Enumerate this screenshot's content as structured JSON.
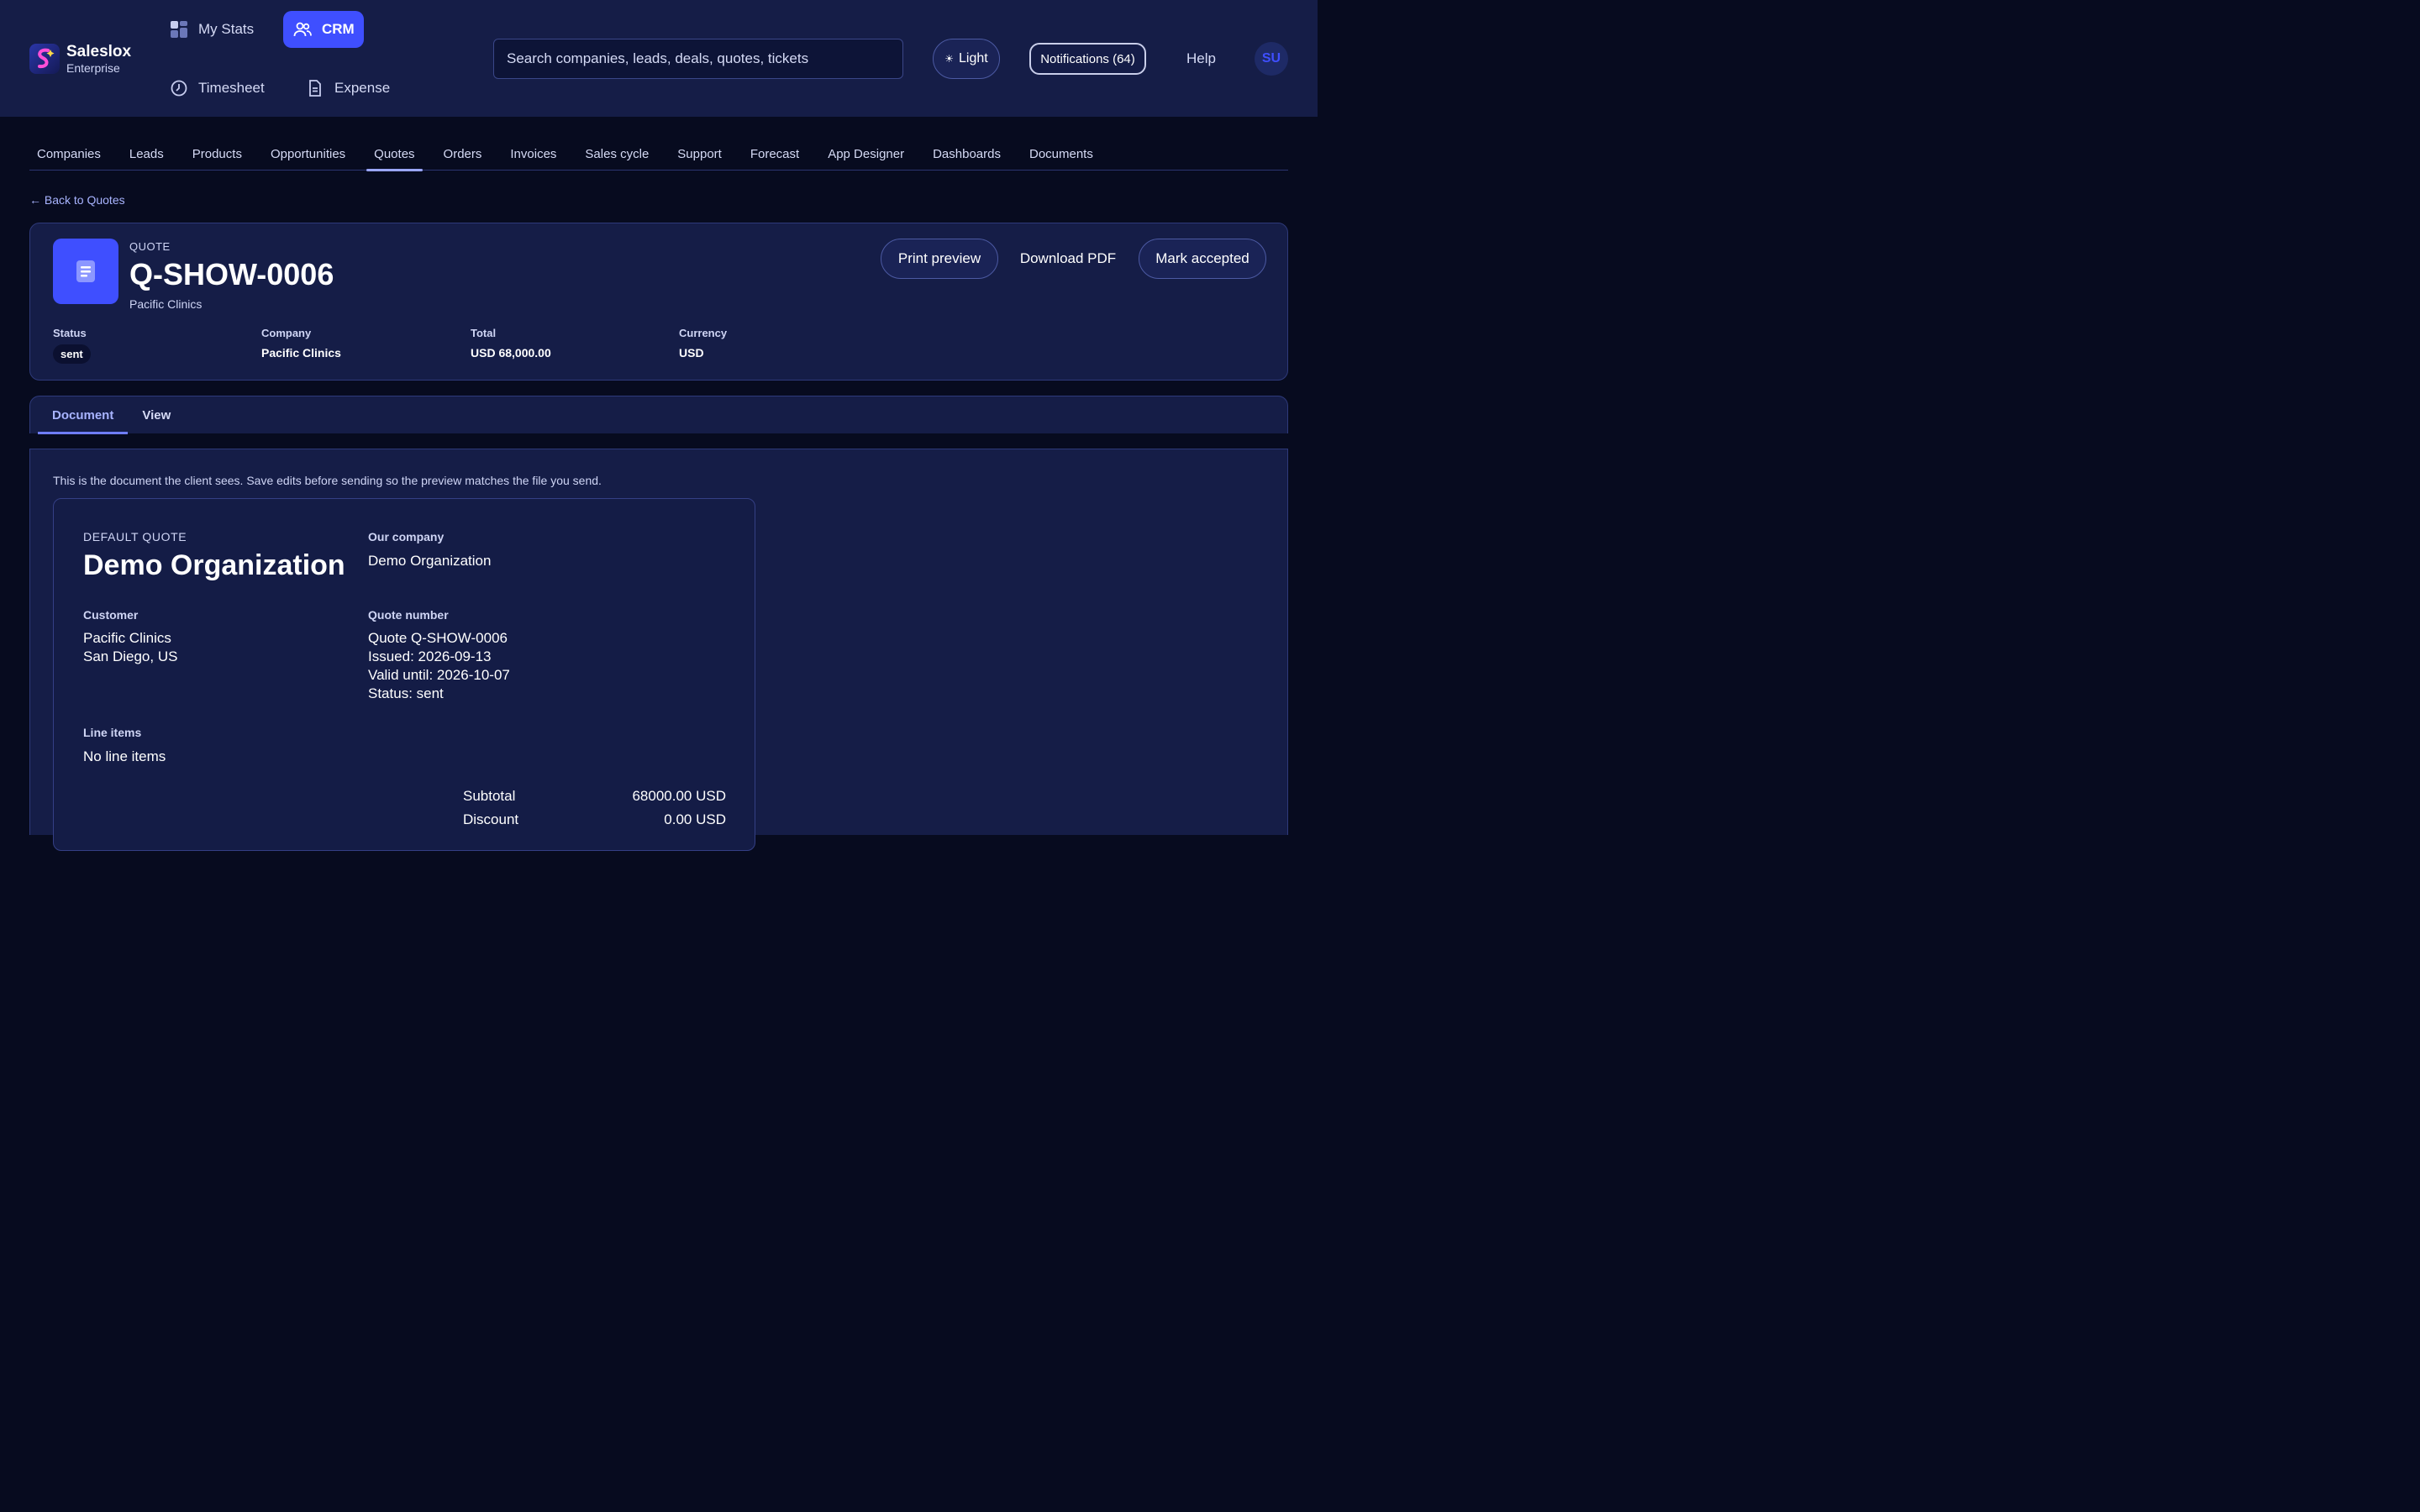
{
  "brand": {
    "name": "Saleslox",
    "tier": "Enterprise"
  },
  "apps": [
    {
      "label": "My Stats",
      "icon": "dashboard-grid-icon"
    },
    {
      "label": "CRM",
      "icon": "users-icon",
      "active": true
    },
    {
      "label": "Timesheet",
      "icon": "clock-icon"
    },
    {
      "label": "Expense",
      "icon": "document-icon"
    }
  ],
  "search": {
    "placeholder": "Search companies, leads, deals, quotes, tickets"
  },
  "header": {
    "theme_label": "Light",
    "notifications_label": "Notifications (64)",
    "help_label": "Help",
    "avatar_initials": "SU"
  },
  "nav": {
    "items": [
      "Companies",
      "Leads",
      "Products",
      "Opportunities",
      "Quotes",
      "Orders",
      "Invoices",
      "Sales cycle",
      "Support",
      "Forecast",
      "App Designer",
      "Dashboards",
      "Documents"
    ],
    "active": "Quotes"
  },
  "back_link": "← Back to Quotes",
  "quote": {
    "kind": "QUOTE",
    "number": "Q-SHOW-0006",
    "company": "Pacific Clinics",
    "actions": {
      "print": "Print preview",
      "download": "Download PDF",
      "accept": "Mark accepted"
    },
    "meta": {
      "status_label": "Status",
      "status_value": "sent",
      "company_label": "Company",
      "company_value": "Pacific Clinics",
      "total_label": "Total",
      "total_value": "USD 68,000.00",
      "currency_label": "Currency",
      "currency_value": "USD"
    }
  },
  "tabs": {
    "document": "Document",
    "view": "View",
    "active": "Document"
  },
  "document": {
    "hint": "This is the document the client sees. Save edits before sending so the preview matches the file you send.",
    "kicker": "DEFAULT QUOTE",
    "org_name": "Demo Organization",
    "our_company_label": "Our company",
    "our_company_value": "Demo Organization",
    "customer_label": "Customer",
    "customer_name": "Pacific Clinics",
    "customer_location": "San Diego, US",
    "quote_number_label": "Quote number",
    "quote_line": "Quote Q-SHOW-0006",
    "issued": "Issued: 2026-09-13",
    "valid_until": "Valid until: 2026-10-07",
    "status": "Status: sent",
    "line_items_label": "Line items",
    "line_items_empty": "No line items",
    "subtotal_label": "Subtotal",
    "subtotal_value": "68000.00 USD",
    "discount_label": "Discount",
    "discount_value": "0.00 USD"
  },
  "colors": {
    "accent": "#3f4fff",
    "background": "#070b1f",
    "panel": "#151d47"
  }
}
